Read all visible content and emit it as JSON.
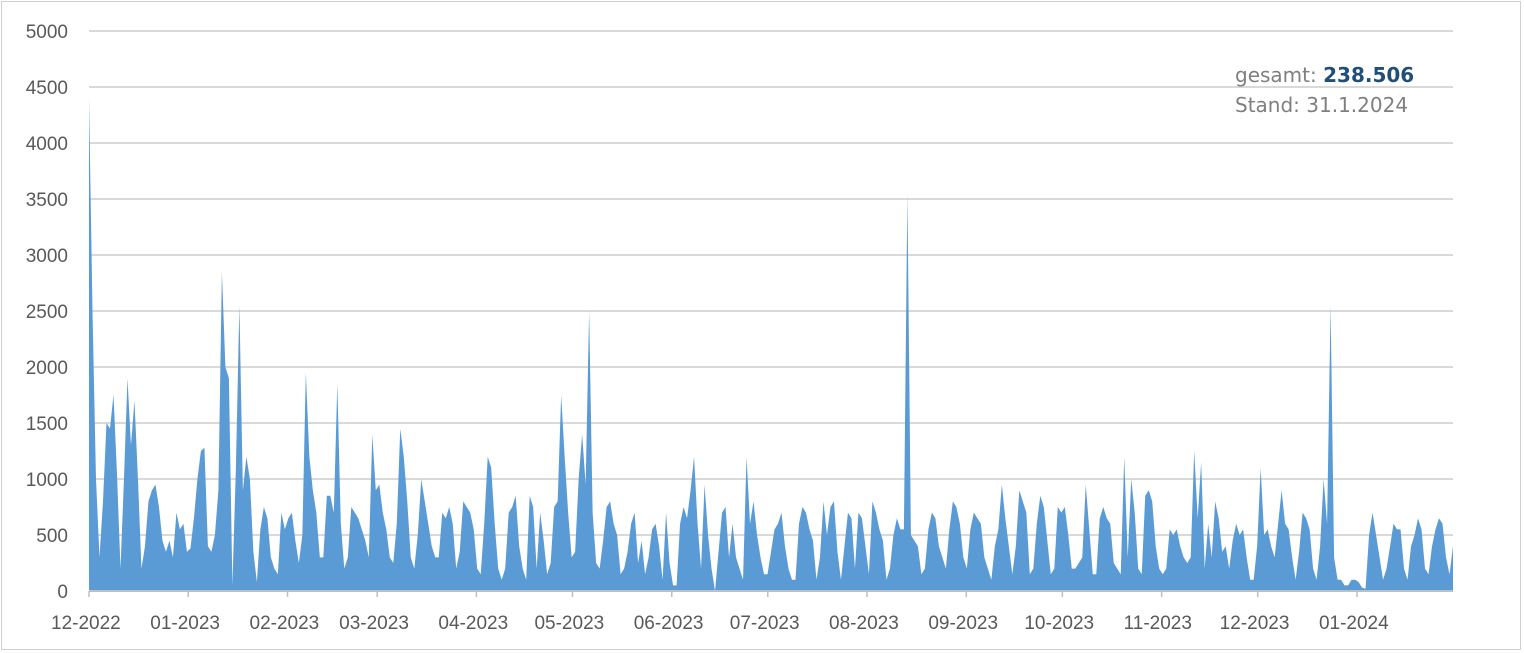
{
  "chart_data": {
    "type": "area",
    "title": "",
    "xlabel": "",
    "ylabel": "",
    "ylim": [
      0,
      5000
    ],
    "yticks": [
      0,
      500,
      1000,
      1500,
      2000,
      2500,
      3000,
      3500,
      4000,
      4500,
      5000
    ],
    "grid": true,
    "legend": "none",
    "x_range": [
      "2022-12-01",
      "2024-01-31"
    ],
    "x_tick_labels": [
      "12-2022",
      "01-2023",
      "02-2023",
      "03-2023",
      "04-2023",
      "05-2023",
      "06-2023",
      "07-2023",
      "08-2023",
      "09-2023",
      "10-2023",
      "11-2023",
      "12-2023",
      "01-2024"
    ],
    "series_color": "#5b9bd5",
    "series": [
      {
        "values": [
          4400,
          2500,
          1000,
          300,
          800,
          1500,
          1450,
          1750,
          1050,
          200,
          1000,
          1900,
          1300,
          1700,
          1000,
          200,
          400,
          800,
          900,
          950,
          750,
          450,
          350,
          450,
          300,
          700,
          550,
          600,
          350,
          380,
          650,
          1000,
          1250,
          1280,
          400,
          350,
          500,
          900,
          2850,
          2000,
          1900,
          50,
          1100,
          2550,
          900,
          1200,
          1000,
          350,
          80,
          550,
          750,
          650,
          300,
          200,
          150,
          700,
          550,
          650,
          700,
          450,
          250,
          500,
          1950,
          1200,
          900,
          700,
          300,
          300,
          850,
          850,
          700,
          1850,
          600,
          200,
          300,
          750,
          700,
          650,
          550,
          450,
          300,
          1400,
          900,
          950,
          700,
          550,
          300,
          250,
          600,
          1450,
          1200,
          800,
          300,
          200,
          500,
          1000,
          800,
          600,
          400,
          300,
          300,
          700,
          650,
          750,
          600,
          200,
          350,
          800,
          750,
          700,
          550,
          200,
          150,
          600,
          1200,
          1100,
          600,
          200,
          100,
          200,
          700,
          750,
          850,
          400,
          200,
          100,
          850,
          750,
          200,
          700,
          450,
          150,
          250,
          750,
          800,
          1750,
          1200,
          700,
          300,
          350,
          1000,
          1400,
          950,
          2500,
          700,
          250,
          200,
          450,
          750,
          800,
          600,
          500,
          150,
          200,
          350,
          600,
          700,
          250,
          450,
          150,
          300,
          550,
          600,
          400,
          100,
          700,
          250,
          50,
          50,
          600,
          750,
          650,
          900,
          1200,
          600,
          200,
          950,
          500,
          200,
          0,
          350,
          700,
          750,
          300,
          600,
          300,
          200,
          100,
          1200,
          600,
          800,
          500,
          300,
          150,
          150,
          350,
          550,
          600,
          700,
          400,
          200,
          100,
          100,
          600,
          750,
          700,
          550,
          450,
          100,
          300,
          800,
          500,
          750,
          800,
          350,
          100,
          400,
          700,
          650,
          200,
          700,
          650,
          400,
          150,
          800,
          700,
          550,
          450,
          100,
          200,
          500,
          650,
          550,
          550,
          3550,
          500,
          450,
          400,
          150,
          200,
          550,
          700,
          650,
          400,
          300,
          200,
          550,
          800,
          750,
          600,
          300,
          200,
          550,
          700,
          650,
          600,
          300,
          200,
          100,
          400,
          550,
          950,
          650,
          400,
          150,
          400,
          900,
          800,
          700,
          150,
          200,
          600,
          850,
          750,
          450,
          150,
          200,
          750,
          700,
          750,
          500,
          200,
          200,
          250,
          300,
          950,
          550,
          150,
          150,
          650,
          750,
          650,
          600,
          250,
          200,
          150,
          1200,
          300,
          1000,
          700,
          200,
          150,
          850,
          900,
          800,
          400,
          200,
          150,
          200,
          550,
          500,
          550,
          400,
          300,
          250,
          300,
          1250,
          650,
          1150,
          200,
          600,
          300,
          800,
          650,
          350,
          400,
          200,
          450,
          600,
          500,
          550,
          300,
          100,
          100,
          400,
          1100,
          500,
          550,
          400,
          300,
          600,
          900,
          600,
          550,
          300,
          100,
          350,
          700,
          650,
          550,
          200,
          100,
          400,
          1000,
          600,
          2550,
          300,
          100,
          100,
          50,
          50,
          100,
          100,
          80,
          30,
          20,
          500,
          700,
          500,
          300,
          100,
          200,
          400,
          600,
          550,
          550,
          200,
          100,
          400,
          500,
          650,
          550,
          200,
          150,
          400,
          550,
          650,
          600,
          300,
          150,
          400
        ]
      }
    ]
  },
  "annotation": {
    "total_label": "gesamt: ",
    "total_value": "238.506",
    "stand_label": "Stand: 31.1.2024"
  }
}
